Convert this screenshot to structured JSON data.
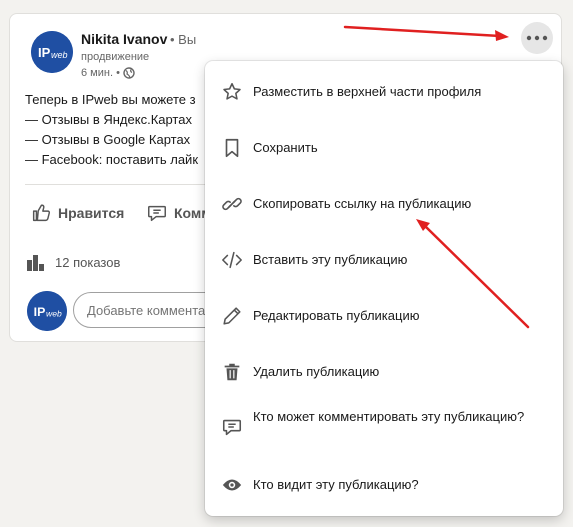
{
  "post": {
    "author_name": "Nikita Ivanov",
    "author_degree": "• Вы",
    "author_subtitle": "продвижение",
    "time": "6 мин. •",
    "text_lines": [
      "Теперь в IPweb вы можете з",
      "— Отзывы в Яндекс.Картах",
      "— Отзывы в Google Картах",
      "— Facebook: поставить лайк"
    ],
    "like_label": "Нравится",
    "comment_label": "Комм",
    "views_label": "12 показов",
    "comment_placeholder": "Добавьте коммента"
  },
  "menu": {
    "items": [
      {
        "label": "Разместить в верхней части профиля",
        "icon": "star-icon"
      },
      {
        "label": "Сохранить",
        "icon": "bookmark-icon"
      },
      {
        "label": "Скопировать ссылку на публикацию",
        "icon": "link-icon"
      },
      {
        "label": "Вставить эту публикацию",
        "icon": "code-icon"
      },
      {
        "label": "Редактировать публикацию",
        "icon": "pencil-icon"
      },
      {
        "label": "Удалить публикацию",
        "icon": "trash-icon"
      },
      {
        "label": "Кто может комментировать эту публикацию?",
        "icon": "comment-icon"
      },
      {
        "label": "Кто видит эту публикацию?",
        "icon": "eye-icon"
      }
    ]
  },
  "colors": {
    "annotation_arrow": "#e02020",
    "avatar_bg": "#1f4fa3"
  }
}
